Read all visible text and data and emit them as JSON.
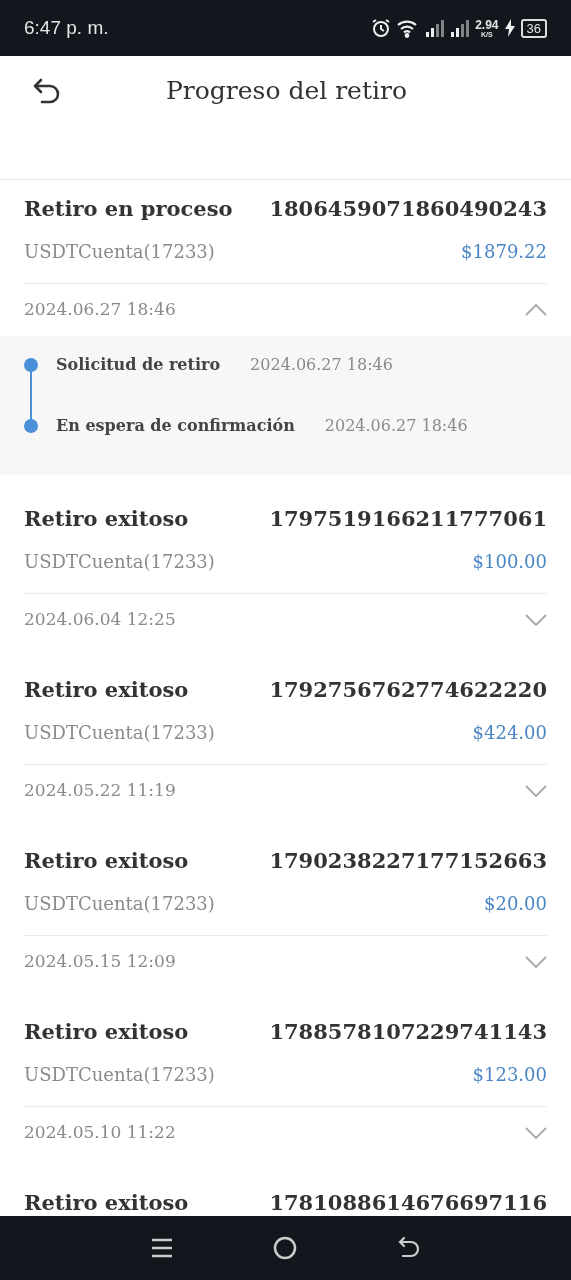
{
  "status_bar": {
    "time": "6:47 p. m.",
    "speed": "2.94",
    "speed_unit": "K/S",
    "battery": "36"
  },
  "header": {
    "title": "Progreso del retiro"
  },
  "records": [
    {
      "status": "Retiro en proceso",
      "id": "1806459071860490243",
      "account": "USDTCuenta(17233)",
      "amount": "$1879.22",
      "date": "2024.06.27 18:46",
      "expanded": true,
      "steps": [
        {
          "label": "Solicitud de retiro",
          "time": "2024.06.27 18:46"
        },
        {
          "label": "En espera de confirmación",
          "time": "2024.06.27 18:46"
        }
      ]
    },
    {
      "status": "Retiro exitoso",
      "id": "1797519166211777061",
      "account": "USDTCuenta(17233)",
      "amount": "$100.00",
      "date": "2024.06.04 12:25",
      "expanded": false
    },
    {
      "status": "Retiro exitoso",
      "id": "1792756762774622220",
      "account": "USDTCuenta(17233)",
      "amount": "$424.00",
      "date": "2024.05.22 11:19",
      "expanded": false
    },
    {
      "status": "Retiro exitoso",
      "id": "1790238227177152663",
      "account": "USDTCuenta(17233)",
      "amount": "$20.00",
      "date": "2024.05.15 12:09",
      "expanded": false
    },
    {
      "status": "Retiro exitoso",
      "id": "1788578107229741143",
      "account": "USDTCuenta(17233)",
      "amount": "$123.00",
      "date": "2024.05.10 11:22",
      "expanded": false
    },
    {
      "status": "Retiro exitoso",
      "id": "1781088614676697116"
    }
  ]
}
